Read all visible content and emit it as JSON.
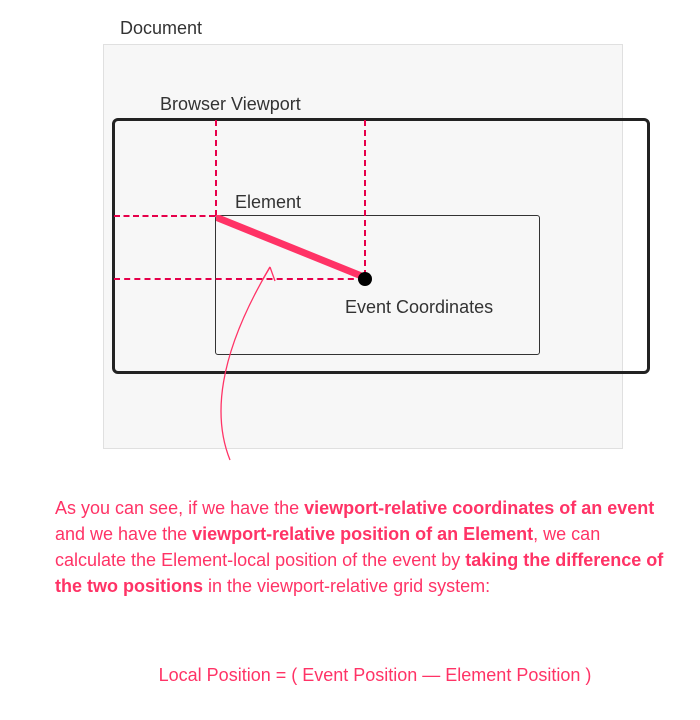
{
  "labels": {
    "document": "Document",
    "viewport": "Browser Viewport",
    "element": "Element",
    "event_coords": "Event Coordinates"
  },
  "explanation": {
    "line1_pre": "As you can see, if we have the ",
    "line1_bold": "viewport-relative coordinates of an event",
    "line1_mid": " and we have the ",
    "line1_bold2": "viewport-relative position of an Element",
    "line1_post": ", we can calculate the Element-local position of the event by ",
    "line1_bold3": "taking the difference of the two positions",
    "line1_end": " in the viewport-relative grid system:"
  },
  "formula": "Local Position = ( Event Position — Element Position )",
  "colors": {
    "pink": "#ff3366",
    "dashed": "#e6004a"
  }
}
